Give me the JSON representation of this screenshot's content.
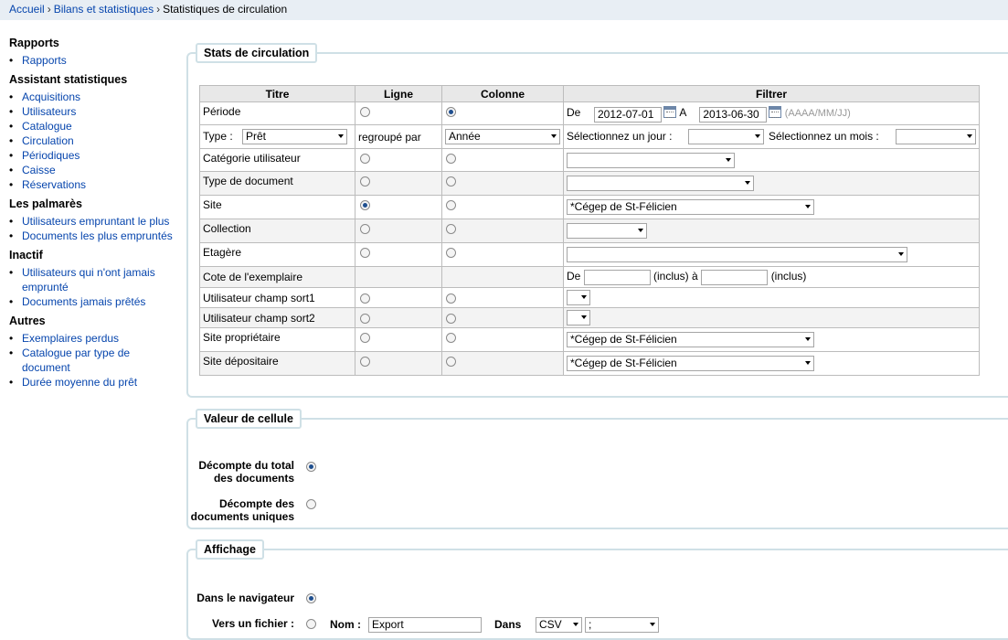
{
  "breadcrumb": {
    "home": "Accueil",
    "reports": "Bilans et statistiques",
    "current": "Statistiques de circulation"
  },
  "sidebar": {
    "groups": [
      {
        "title": "Rapports",
        "items": [
          "Rapports"
        ]
      },
      {
        "title": "Assistant statistiques",
        "items": [
          "Acquisitions",
          "Utilisateurs",
          "Catalogue",
          "Circulation",
          "Périodiques",
          "Caisse",
          "Réservations"
        ]
      },
      {
        "title": "Les palmarès",
        "items": [
          "Utilisateurs empruntant le plus",
          "Documents les plus empruntés"
        ]
      },
      {
        "title": "Inactif",
        "items": [
          "Utilisateurs qui n'ont jamais emprunté",
          "Documents jamais prêtés"
        ]
      },
      {
        "title": "Autres",
        "items": [
          "Exemplaires perdus",
          "Catalogue par type de document",
          "Durée moyenne du prêt"
        ]
      }
    ]
  },
  "stats": {
    "legend": "Stats de circulation",
    "headers": {
      "title": "Titre",
      "row": "Ligne",
      "column": "Colonne",
      "filter": "Filtrer"
    },
    "period": {
      "label": "Période",
      "from_label": "De",
      "from": "2012-07-01",
      "to_label": "A",
      "to": "2013-06-30",
      "format_hint": "(AAAA/MM/JJ)"
    },
    "type": {
      "label": "Type :",
      "value": "Prêt",
      "grouped_label": "regroupé par",
      "grouped_value": "Année",
      "day_label": "Sélectionnez un jour :",
      "month_label": "Sélectionnez un mois :"
    },
    "category": "Catégorie utilisateur",
    "doctype": "Type de document",
    "site": {
      "label": "Site",
      "value": "*Cégep de St-Félicien"
    },
    "collection": "Collection",
    "shelf": "Etagère",
    "callnumber": {
      "label": "Cote de l'exemplaire",
      "from_label": "De",
      "incl1": "(inclus) à",
      "incl2": "(inclus)"
    },
    "sort1": "Utilisateur champ sort1",
    "sort2": "Utilisateur champ sort2",
    "owner": {
      "label": "Site propriétaire",
      "value": "*Cégep de St-Félicien"
    },
    "holder": {
      "label": "Site dépositaire",
      "value": "*Cégep de St-Félicien"
    }
  },
  "cell": {
    "legend": "Valeur de cellule",
    "total": "Décompte du total des documents",
    "unique": "Décompte des documents uniques"
  },
  "display": {
    "legend": "Affichage",
    "browser": "Dans le navigateur",
    "file": "Vers un fichier :",
    "name_label": "Nom :",
    "name_value": "Export",
    "in_label": "Dans",
    "format": "CSV",
    "separator": ";"
  }
}
